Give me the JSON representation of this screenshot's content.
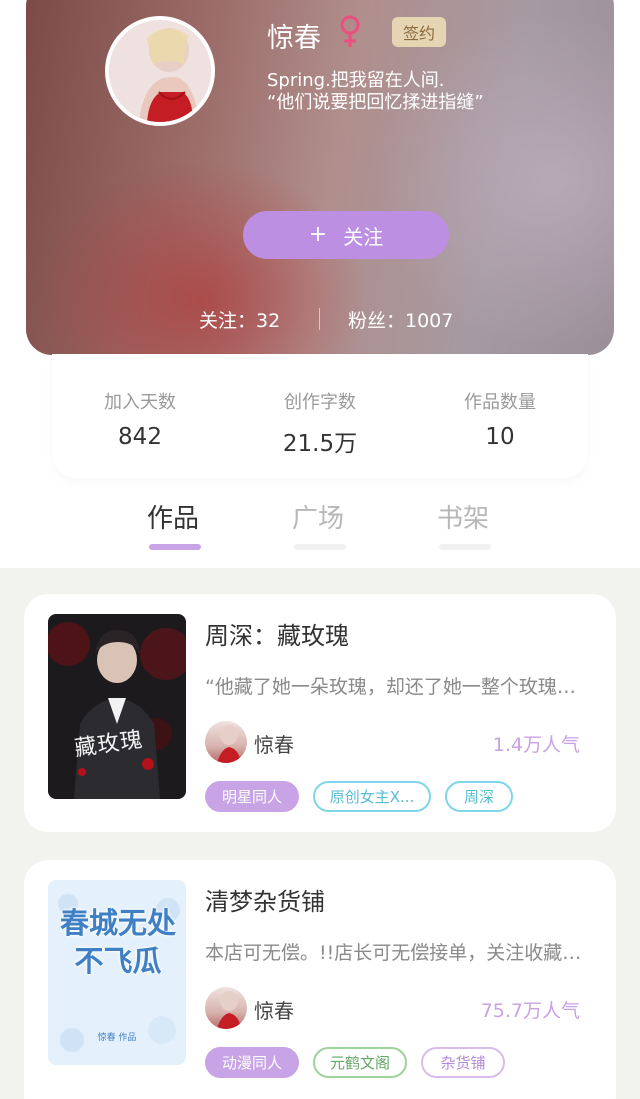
{
  "profile": {
    "name": "惊春",
    "gender_icon": "female-icon",
    "badge": "签约",
    "bio_line1": "Spring.把我留在人间.",
    "bio_line2": "“他们说要把回忆揉进指缝”",
    "follow_button": "关注",
    "follow_icon": "plus-icon",
    "following": "关注：32",
    "fans": "粉丝：1007"
  },
  "stats": {
    "joined_label": "加入天数",
    "joined_value": "842",
    "words_label": "创作字数",
    "words_value": "21.5万",
    "works_label": "作品数量",
    "works_value": "10"
  },
  "tabs": [
    {
      "label": "作品",
      "active": true
    },
    {
      "label": "广场",
      "active": false
    },
    {
      "label": "书架",
      "active": false
    }
  ],
  "books": [
    {
      "title": "周深：藏玫瑰",
      "description": "“他藏了她一朵玫瑰，却还了她一整个玫瑰园”",
      "cover_text": "藏玫瑰",
      "author": "惊春",
      "popularity": "1.4万人气",
      "tags": [
        {
          "label": "明星同人",
          "style": "filled"
        },
        {
          "label": "原创女主X...",
          "style": "cyan"
        },
        {
          "label": "周深",
          "style": "cyan"
        }
      ]
    },
    {
      "title": "清梦杂货铺",
      "description": "本店可无偿。!!店长可无偿接单，关注收藏点赞即可",
      "cover_text": "春城无处不飞瓜",
      "cover_subtext": "惊春 作品",
      "author": "惊春",
      "popularity": "75.7万人气",
      "tags": [
        {
          "label": "动漫同人",
          "style": "filled"
        },
        {
          "label": "元鹤文阁",
          "style": "green"
        },
        {
          "label": "杂货铺",
          "style": "lilac"
        }
      ]
    }
  ],
  "colors": {
    "accent": "#bd8fe3",
    "tab_active_underline": "#c8a4e6",
    "popularity": "#c9a2e2",
    "badge_bg": "#e6d5b3"
  }
}
